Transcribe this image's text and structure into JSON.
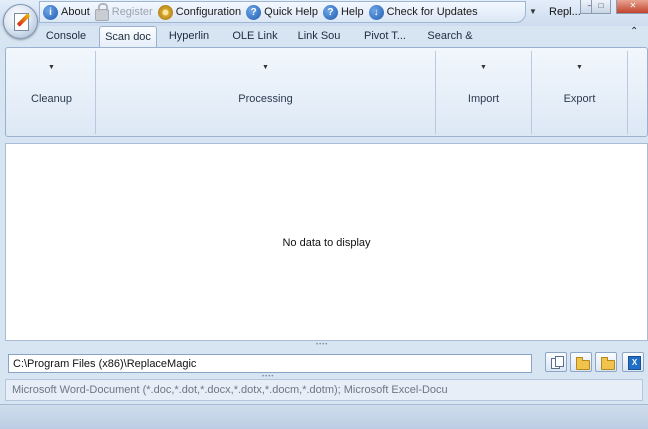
{
  "titlebar": {
    "quick_access": [
      {
        "label": "About",
        "icon": "info-icon",
        "enabled": true
      },
      {
        "label": "Register",
        "icon": "lock-icon",
        "enabled": false
      },
      {
        "label": "Configuration",
        "icon": "gear-icon",
        "enabled": true
      },
      {
        "label": "Quick Help",
        "icon": "help-icon",
        "enabled": true
      },
      {
        "label": "Help",
        "icon": "help-icon",
        "enabled": true
      },
      {
        "label": "Check for Updates",
        "icon": "download-icon",
        "enabled": true
      }
    ],
    "window_title": "Repl..."
  },
  "tabs": [
    "Console",
    "Scan doc",
    "Hyperlin",
    "OLE Link",
    "Link Sou",
    "Pivot T...",
    "Search &"
  ],
  "active_tab": 1,
  "ribbon": {
    "groups": [
      {
        "label": "Cleanup"
      },
      {
        "label": "Processing"
      },
      {
        "label": "Import"
      },
      {
        "label": "Export"
      }
    ]
  },
  "grid": {
    "empty_message": "No data to display"
  },
  "path": {
    "value": "C:\\Program Files (x86)\\ReplaceMagic"
  },
  "filter": {
    "text": "Microsoft Word-Document (*.doc,*.dot,*.docx,*.dotx,*.docm,*.dotm); Microsoft Excel-Docu"
  },
  "colors": {
    "accent": "#1f5bb0",
    "ribbon_bg": "#dde8f5",
    "window_bg": "#d7e5f3"
  }
}
